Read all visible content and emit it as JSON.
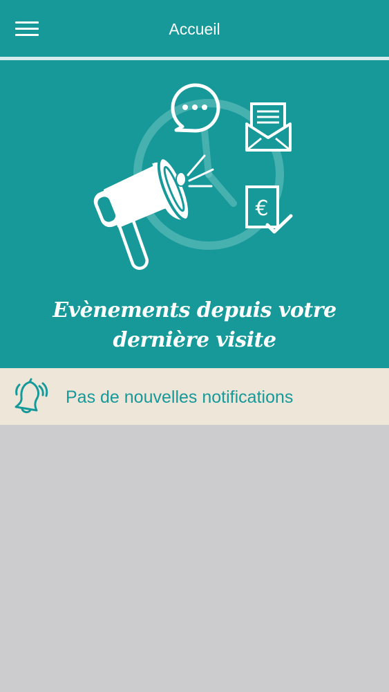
{
  "header": {
    "title": "Accueil",
    "menu_icon": "hamburger-menu-icon"
  },
  "hero": {
    "title_line1": "Evènements depuis votre",
    "title_line2": "dernière visite",
    "illustration_icons": [
      "megaphone-icon",
      "clock-icon",
      "chat-bubble-icon",
      "envelope-icon",
      "invoice-euro-icon"
    ],
    "euro_symbol": "€"
  },
  "notification": {
    "icon": "bell-icon",
    "text": "Pas de nouvelles notifications"
  },
  "colors": {
    "primary": "#17999a",
    "notification_background": "#efe6da",
    "content_background": "#cccbcd"
  }
}
